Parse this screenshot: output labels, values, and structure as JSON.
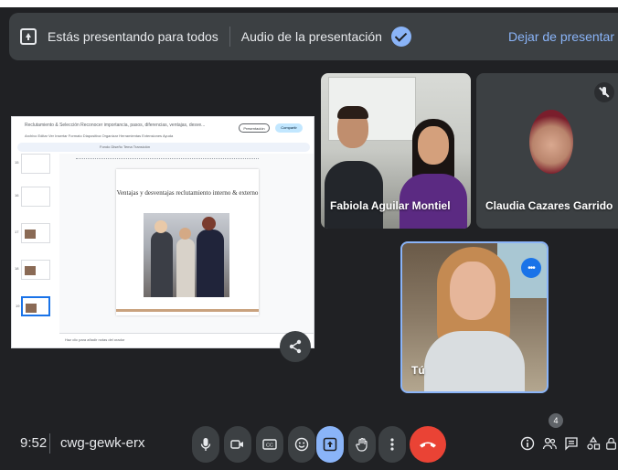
{
  "banner": {
    "presenting_text": "Estás presentando para todos",
    "audio_text": "Audio de la presentación",
    "stop_label": "Dejar de presentar"
  },
  "slides_app": {
    "doc_title": "Reclutamiento & Selección Reconocer importancia, pasos, diferencias, ventajas, desve...",
    "menu": "Archivo  Editar  Ver  Insertar  Formato  Diapositiva  Organizar  Herramientas  Extensiones  Ayuda",
    "toolbar_text": "Fondo  Diseño  Tema  Transición",
    "present_button": "Presentación",
    "share_button": "Compartir",
    "slide_title": "Ventajas y desventajas reclutamiento interno & externo",
    "notes_placeholder": "Haz clic para añadir notas del orador",
    "thumb_numbers": [
      "15",
      "16",
      "17",
      "18",
      "19"
    ]
  },
  "participants": [
    {
      "name": "Fabiola Aguilar Montiel"
    },
    {
      "name": "Claudia Cazares Garrido"
    },
    {
      "name": "Tú"
    }
  ],
  "footer": {
    "time": "9:52",
    "meeting_code": "cwg-gewk-erx",
    "people_count": "4"
  },
  "colors": {
    "background": "#202124",
    "accent_blue": "#8ab4f8",
    "hangup_red": "#ea4335"
  }
}
